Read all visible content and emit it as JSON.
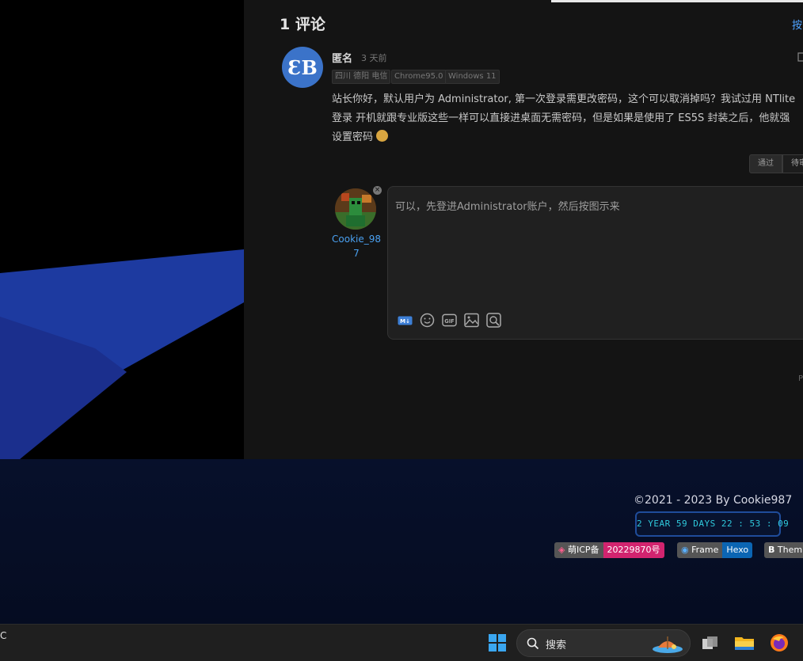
{
  "comments": {
    "count_label": "1 评论",
    "sort_label": "按",
    "item": {
      "author": "匿名",
      "time": "3 天前",
      "tags": [
        "四川 德阳 电信",
        "Chrome95.0",
        "Windows 11"
      ],
      "text_line1": "站长你好，默认用户为 Administrator, 第一次登录需更改密码，这个可以取消掉吗？我试过用 NTlite",
      "text_line2": "登录 开机就跟专业版这些一样可以直接进桌面无需密码，但是如果是使用了 ES5S 封装之后，他就强",
      "text_line3": "设置密码",
      "emoji": "face-emoji"
    },
    "actions": {
      "approve_label": "通过",
      "pending_label": "待审"
    },
    "reply": {
      "username": "Cookie_987",
      "draft_text": "可以，先登进Administrator账户，然后按图示来",
      "tools": [
        "markdown-icon",
        "emoji-icon",
        "gif-icon",
        "image-icon",
        "preview-icon"
      ]
    },
    "footer_mark": "P"
  },
  "footer": {
    "copyright": "©2021 - 2023 By Cookie987",
    "runtime": "2 YEAR 59 DAYS 22 : 53 : 09",
    "badges": [
      {
        "left": "萌ICP备",
        "right": "20229870号",
        "color": "#d2246f"
      },
      {
        "left": "Frame",
        "right": "Hexo",
        "color": "#0b65b3"
      },
      {
        "left": "Them",
        "right": "",
        "color": "#555"
      }
    ]
  },
  "taskbar": {
    "left_text": "C",
    "search_label": "搜索"
  },
  "colors": {
    "accent_blue": "#4ea2ff",
    "panel_bg": "#141414",
    "footer_bg": "#07102b"
  }
}
